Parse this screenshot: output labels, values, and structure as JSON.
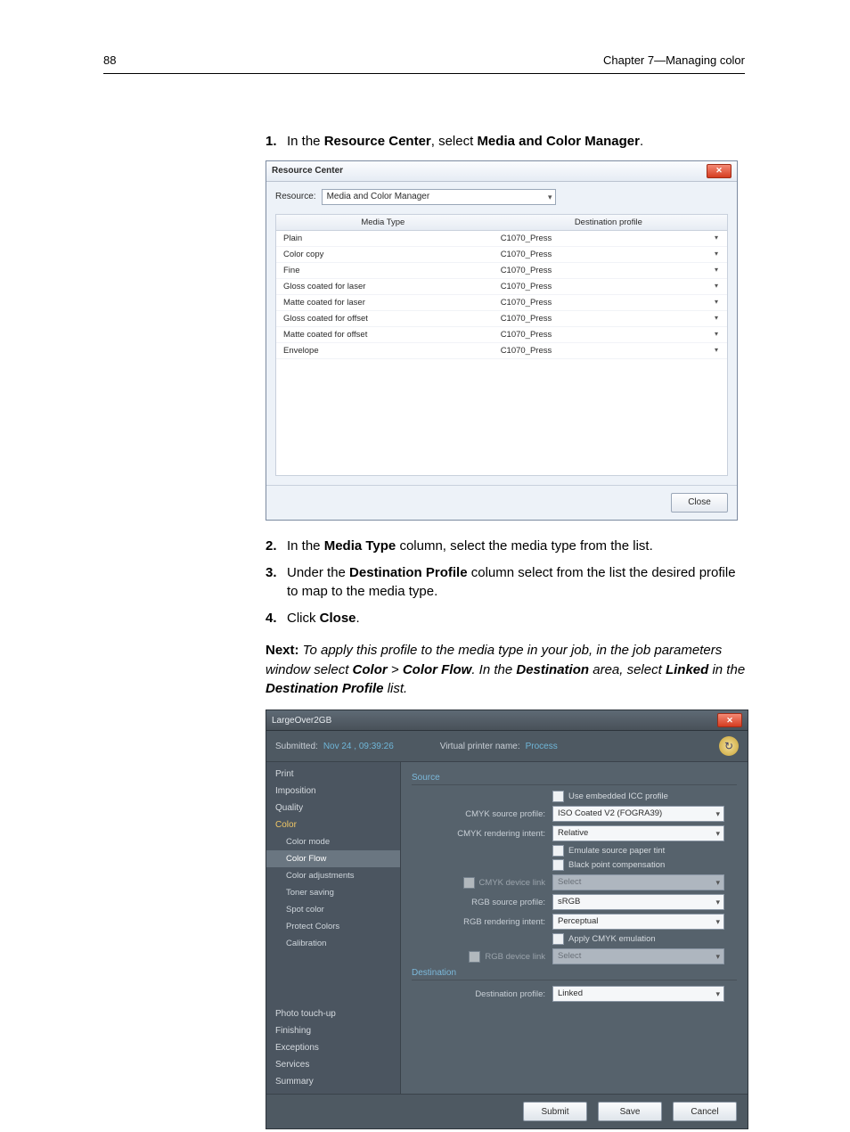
{
  "page": {
    "number": "88",
    "chapter": "Chapter 7—Managing color"
  },
  "steps": [
    {
      "n": "1.",
      "pre": "In the ",
      "b1": "Resource Center",
      "mid": ", select ",
      "b2": "Media and Color Manager",
      "post": "."
    },
    {
      "n": "2.",
      "pre": "In the ",
      "b1": "Media Type",
      "mid": " column, select the media type from the list.",
      "b2": "",
      "post": ""
    },
    {
      "n": "3.",
      "pre": "Under the ",
      "b1": "Destination Profile",
      "mid": " column select from the list the desired profile to map to the media type.",
      "b2": "",
      "post": ""
    },
    {
      "n": "4.",
      "pre": "Click ",
      "b1": "Close",
      "mid": ".",
      "b2": "",
      "post": ""
    }
  ],
  "next": {
    "label": "Next:",
    "t1": " To apply this profile to the media type in your job, in the job parameters window select ",
    "b1": "Color",
    "t2": " > ",
    "b2": "Color Flow",
    "t3": ". In the ",
    "b3": "Destination",
    "t4": " area, select ",
    "b4": "Linked",
    "t5": " in the ",
    "b5": "Destination Profile",
    "t6": " list."
  },
  "rc": {
    "title": "Resource Center",
    "resourceLabel": "Resource:",
    "resourceValue": "Media and Color Manager",
    "cols": {
      "media": "Media Type",
      "dest": "Destination profile"
    },
    "rows": [
      {
        "media": "Plain",
        "dest": "C1070_Press"
      },
      {
        "media": "Color copy",
        "dest": "C1070_Press"
      },
      {
        "media": "Fine",
        "dest": "C1070_Press"
      },
      {
        "media": "Gloss coated for laser",
        "dest": "C1070_Press"
      },
      {
        "media": "Matte coated for laser",
        "dest": "C1070_Press"
      },
      {
        "media": "Gloss coated for offset",
        "dest": "C1070_Press"
      },
      {
        "media": "Matte coated for offset",
        "dest": "C1070_Press"
      },
      {
        "media": "Envelope",
        "dest": "C1070_Press"
      }
    ],
    "closeBtn": "Close"
  },
  "jp": {
    "title": "LargeOver2GB",
    "submittedLabel": "Submitted:",
    "submittedValue": "Nov 24 , 09:39:26",
    "vpnLabel": "Virtual printer name:",
    "vpnValue": "Process",
    "nav": {
      "print": "Print",
      "imposition": "Imposition",
      "quality": "Quality",
      "color": "Color",
      "colorMode": "Color mode",
      "colorFlow": "Color Flow",
      "colorAdjustments": "Color adjustments",
      "tonerSaving": "Toner saving",
      "spotColor": "Spot color",
      "protectColors": "Protect Colors",
      "calibration": "Calibration",
      "photoTouchup": "Photo touch-up",
      "finishing": "Finishing",
      "exceptions": "Exceptions",
      "services": "Services",
      "summary": "Summary"
    },
    "panel": {
      "sourceHeader": "Source",
      "useEmbedded": "Use embedded ICC profile",
      "cmykProfileLabel": "CMYK source profile:",
      "cmykProfileValue": "ISO Coated V2 (FOGRA39)",
      "cmykIntentLabel": "CMYK rendering intent:",
      "cmykIntentValue": "Relative",
      "emulatePaper": "Emulate source paper tint",
      "blackPoint": "Black point compensation",
      "cmykDeviceLinkLabel": "CMYK device link",
      "cmykDeviceLinkValue": "Select",
      "rgbProfileLabel": "RGB source profile:",
      "rgbProfileValue": "sRGB",
      "rgbIntentLabel": "RGB rendering intent:",
      "rgbIntentValue": "Perceptual",
      "applyCmykEmu": "Apply CMYK emulation",
      "rgbDeviceLinkLabel": "RGB device link",
      "rgbDeviceLinkValue": "Select",
      "destHeader": "Destination",
      "destProfileLabel": "Destination profile:",
      "destProfileValue": "Linked"
    },
    "buttons": {
      "submit": "Submit",
      "save": "Save",
      "cancel": "Cancel"
    }
  }
}
